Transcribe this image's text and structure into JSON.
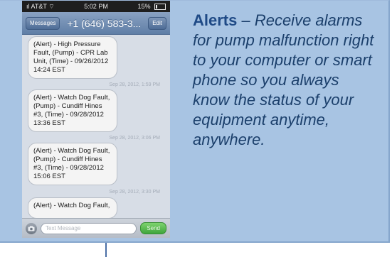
{
  "phone": {
    "status_bar": {
      "carrier": "AT&T",
      "time": "5:02 PM",
      "battery": "15%"
    },
    "nav": {
      "back_label": "Messages",
      "title": "+1 (646) 583-3...",
      "edit_label": "Edit"
    },
    "messages": [
      {
        "text": "(Alert) - High Pressure Fault, (Pump) - CPR Lab Unit, (Time) - 09/26/2012 14:24 EST"
      },
      {
        "timestamp": "Sep 28, 2012, 1:59 PM",
        "text": "(Alert) - Watch Dog Fault, (Pump) - Cundiff Hines #3, (Time) - 09/28/2012 13:36 EST"
      },
      {
        "timestamp": "Sep 28, 2012, 3:06 PM",
        "text": "(Alert) - Watch Dog Fault, (Pump) - Cundiff Hines #3, (Time) - 09/28/2012 15:06 EST"
      },
      {
        "timestamp": "Sep 28, 2012, 3:30 PM",
        "text": "(Alert) - Watch Dog Fault,"
      }
    ],
    "input": {
      "placeholder": "Text Message",
      "send_label": "Send"
    }
  },
  "description": {
    "title": "Alerts",
    "dash": " – ",
    "body": "Receive alarms for pump malfunction right to your computer or smart phone so you always know the status of your equipment anytime, anywhere."
  },
  "colors": {
    "panel_bg": "#a8c4e3",
    "title_color": "#1f4a86",
    "body_color": "#1b3f6b",
    "nav_bar": "#6f8db3",
    "send_button": "#4cb046"
  }
}
